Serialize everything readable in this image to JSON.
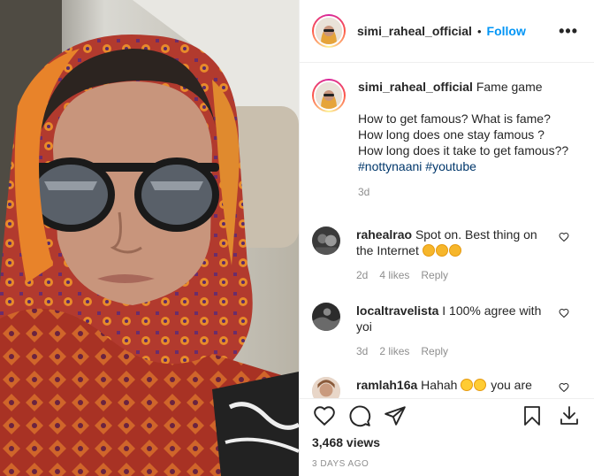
{
  "header": {
    "username": "simi_raheal_official",
    "dot": "•",
    "follow_label": "Follow",
    "more_icon": "more-horizontal-icon"
  },
  "caption": {
    "username": "simi_raheal_official",
    "title": "Fame game",
    "text": "How to get famous? What is fame? How long does one stay famous ? How long does it take to get famous??",
    "hashtags": [
      "#nottynaani",
      "#youtube"
    ],
    "age": "3d"
  },
  "comments": [
    {
      "username": "rahealrao",
      "text": "Spot on. Best thing on the Internet",
      "emoji_count": 3,
      "age": "2d",
      "likes": "4 likes",
      "reply": "Reply"
    },
    {
      "username": "localtravelista",
      "text": "I 100% agree with yoi",
      "age": "3d",
      "likes": "2 likes",
      "reply": "Reply"
    },
    {
      "username": "ramlah16a",
      "text": "Hahah",
      "text_after": "you are"
    }
  ],
  "actions": {
    "views": "3,468 views",
    "time": "3 DAYS AGO"
  },
  "colors": {
    "accent": "#0095f6",
    "hashtag": "#00376b",
    "muted": "#8e8e8e",
    "text": "#262626"
  }
}
